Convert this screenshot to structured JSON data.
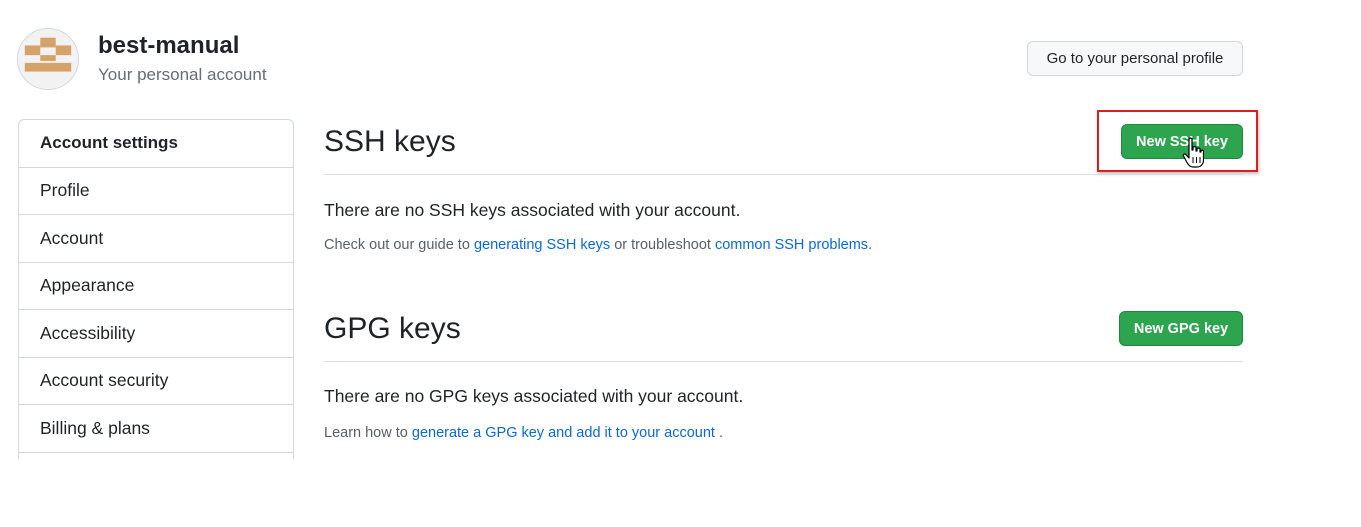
{
  "header": {
    "account_name": "best-manual",
    "account_subtitle": "Your personal account",
    "profile_button": "Go to your personal profile",
    "avatar_color": "#d5a36a"
  },
  "sidebar": {
    "heading": "Account settings",
    "items": [
      {
        "label": "Profile"
      },
      {
        "label": "Account"
      },
      {
        "label": "Appearance"
      },
      {
        "label": "Accessibility"
      },
      {
        "label": "Account security"
      },
      {
        "label": "Billing & plans"
      }
    ]
  },
  "ssh": {
    "title": "SSH keys",
    "new_button": "New SSH key",
    "empty_message": "There are no SSH keys associated with your account.",
    "help_prefix": "Check out our guide to",
    "help_link1": "generating SSH keys",
    "help_middle": "or troubleshoot",
    "help_link2": "common SSH problems",
    "help_suffix": "."
  },
  "gpg": {
    "title": "GPG keys",
    "new_button": "New GPG key",
    "empty_message": "There are no GPG keys associated with your account.",
    "help_prefix": "Learn how to",
    "help_link": "generate a GPG key and add it to your account",
    "help_suffix": "."
  },
  "colors": {
    "primary_button": "#2da44e",
    "link": "#0969da",
    "highlight": "#d9201e"
  },
  "icons": {
    "cursor": "hand-pointer-cursor-icon"
  }
}
